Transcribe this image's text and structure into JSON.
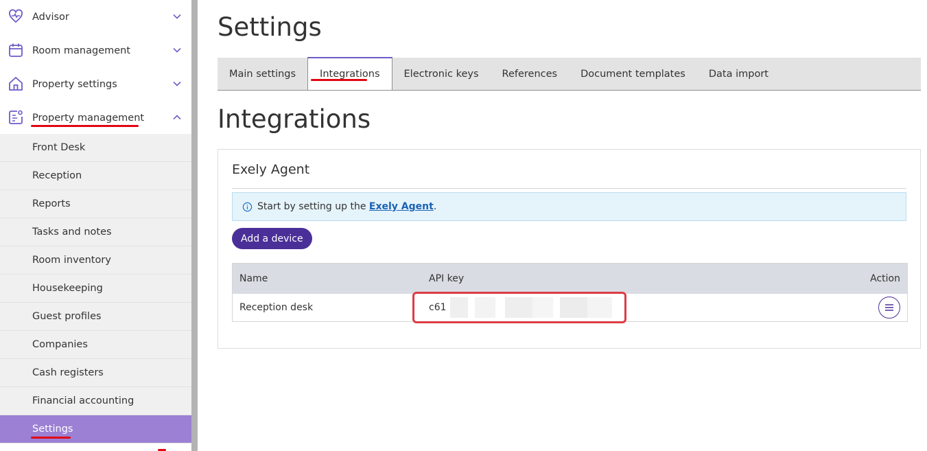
{
  "sidebar": {
    "items": [
      {
        "label": "Advisor",
        "icon": "heart-pulse-icon"
      },
      {
        "label": "Room management",
        "icon": "calendar-icon"
      },
      {
        "label": "Property settings",
        "icon": "home-icon"
      },
      {
        "label": "Property management",
        "icon": "clipboard-user-icon"
      }
    ],
    "sub_items": [
      {
        "label": "Front Desk"
      },
      {
        "label": "Reception"
      },
      {
        "label": "Reports"
      },
      {
        "label": "Tasks and notes"
      },
      {
        "label": "Room inventory"
      },
      {
        "label": "Housekeeping"
      },
      {
        "label": "Guest profiles"
      },
      {
        "label": "Companies"
      },
      {
        "label": "Cash registers"
      },
      {
        "label": "Financial accounting"
      },
      {
        "label": "Settings"
      }
    ]
  },
  "page": {
    "title": "Settings",
    "tabs": [
      {
        "label": "Main settings"
      },
      {
        "label": "Integrations"
      },
      {
        "label": "Electronic keys"
      },
      {
        "label": "References"
      },
      {
        "label": "Document templates"
      },
      {
        "label": "Data import"
      }
    ],
    "section_title": "Integrations"
  },
  "card": {
    "title": "Exely Agent",
    "info_prefix": "Start by setting up the ",
    "info_link": "Exely Agent",
    "info_suffix": ".",
    "add_button": "Add a device"
  },
  "table": {
    "headers": {
      "name": "Name",
      "api_key": "API key",
      "action": "Action"
    },
    "rows": [
      {
        "name": "Reception desk",
        "api_key": "c61"
      }
    ]
  },
  "colors": {
    "accent": "#4b2f98",
    "active_sidebar": "#9b80d3",
    "annotation_red": "#e30613",
    "info_bg": "#e5f3fb"
  }
}
